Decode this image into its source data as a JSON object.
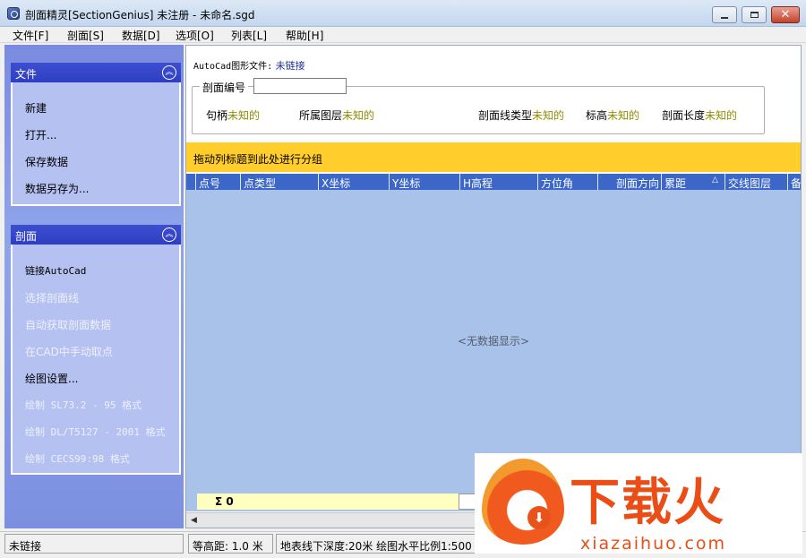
{
  "window": {
    "title": "剖面精灵[SectionGenius] 未注册 - 未命名.sgd"
  },
  "menu": [
    {
      "label": "文件[F]"
    },
    {
      "label": "剖面[S]"
    },
    {
      "label": "数据[D]"
    },
    {
      "label": "选项[O]"
    },
    {
      "label": "列表[L]"
    },
    {
      "label": "帮助[H]"
    }
  ],
  "sidebar": {
    "file_group": {
      "title": "文件",
      "items": [
        {
          "label": "新建",
          "enabled": true
        },
        {
          "label": "打开...",
          "enabled": true
        },
        {
          "label": "保存数据",
          "enabled": true
        },
        {
          "label": "数据另存为...",
          "enabled": true
        }
      ]
    },
    "section_group": {
      "title": "剖面",
      "items": [
        {
          "label": "链接AutoCad",
          "enabled": true
        },
        {
          "label": "选择剖面线",
          "enabled": false
        },
        {
          "label": "自动获取剖面数据",
          "enabled": false
        },
        {
          "label": "在CAD中手动取点",
          "enabled": false
        },
        {
          "label": "绘图设置...",
          "enabled": true
        },
        {
          "label": "绘制 SL73.2 - 95 格式",
          "enabled": false
        },
        {
          "label": "绘制 DL/T5127 - 2001 格式",
          "enabled": false
        },
        {
          "label": "绘制 CECS99:98 格式",
          "enabled": false
        }
      ]
    }
  },
  "main": {
    "autocad": {
      "label": "AutoCad图形文件:",
      "value": "未链接"
    },
    "section_box": {
      "label": "剖面编号",
      "input_value": "",
      "props": [
        {
          "label": "句柄",
          "value": "未知的"
        },
        {
          "label": "所属图层",
          "value": "未知的"
        },
        {
          "label": "剖面线类型",
          "value": "未知的"
        },
        {
          "label": "标高",
          "value": "未知的"
        },
        {
          "label": "剖面长度",
          "value": "未知的"
        }
      ]
    },
    "grouping_prompt": "拖动列标题到此处进行分组",
    "grid": {
      "columns": [
        "点号",
        "点类型",
        "X坐标",
        "Y坐标",
        "H高程",
        "方位角",
        "剖面方向",
        "累距",
        "交线图层",
        "备"
      ],
      "sort_indicator": "△",
      "empty_text": "<无数据显示>",
      "summary_label": "Σ 0"
    }
  },
  "statusbar": {
    "connection": "未链接",
    "contour": "等高距: 1.0 米",
    "depth_scale": "地表线下深度:20米  绘图水平比例1:500 / 垂直比例1:500"
  },
  "watermark": {
    "text": "下载火",
    "url": "xiazaihuo.com",
    "color": "#ea4d16"
  }
}
